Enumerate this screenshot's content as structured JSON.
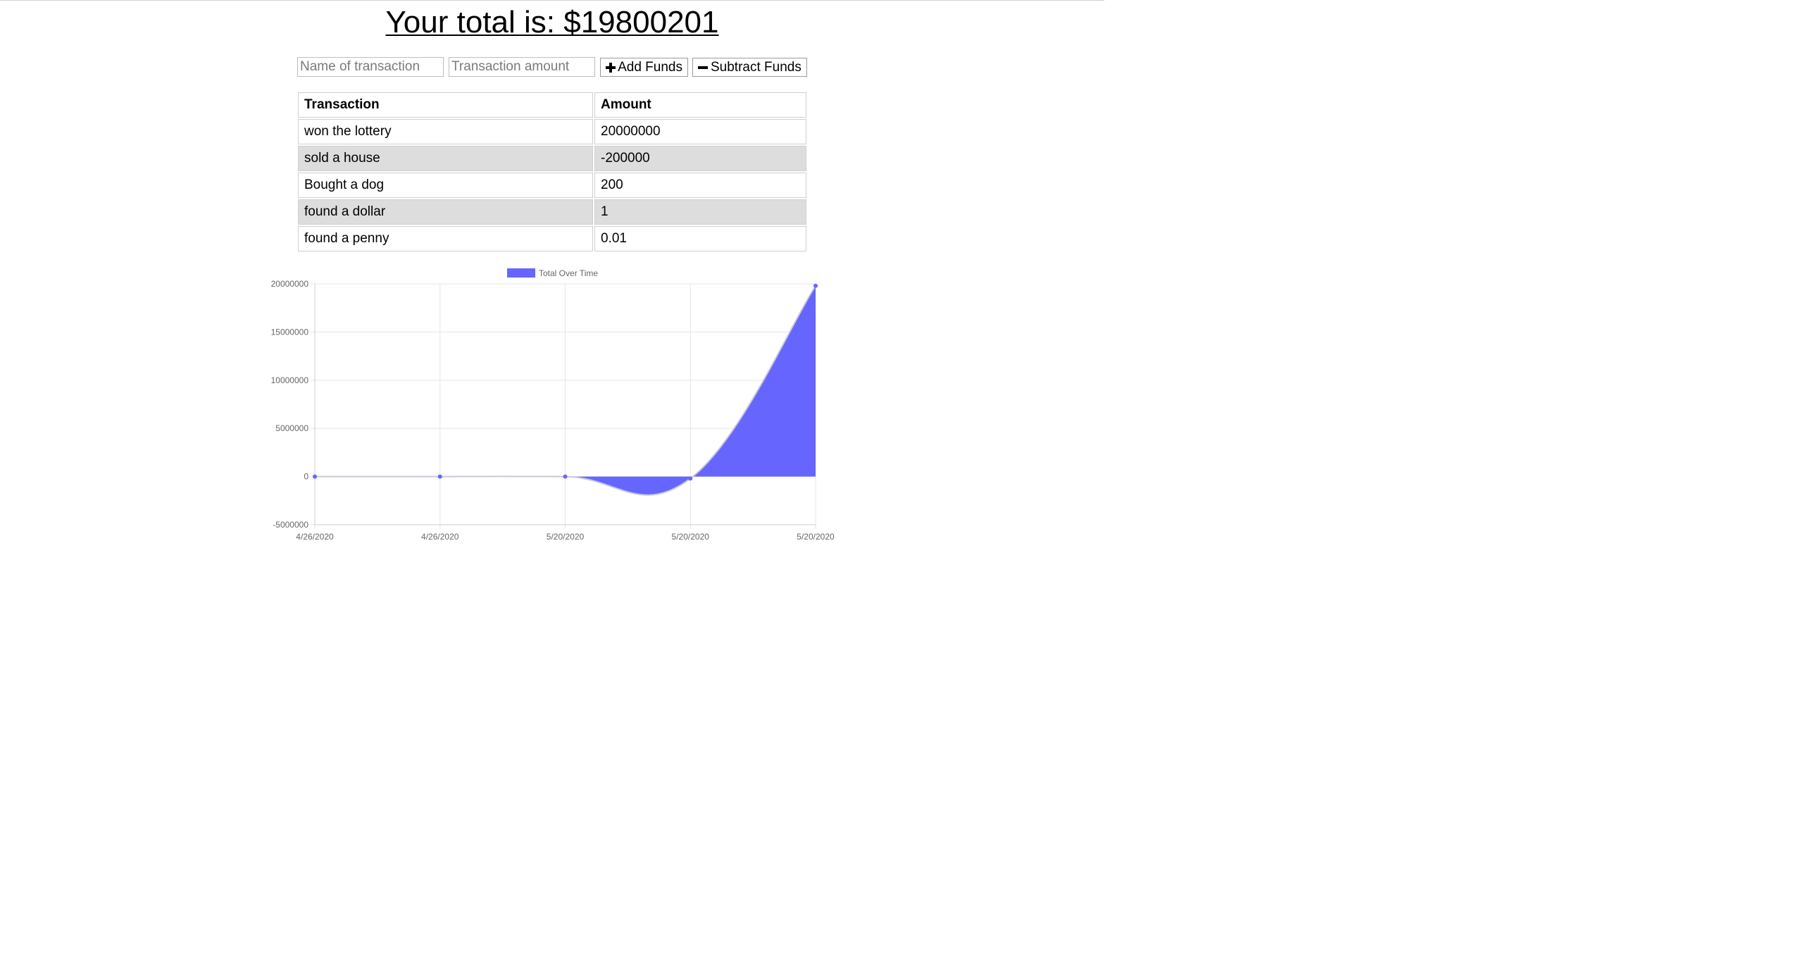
{
  "header": {
    "total_text": "Your total is: $19800201"
  },
  "form": {
    "name_placeholder": "Name of transaction",
    "amount_placeholder": "Transaction amount",
    "add_label": "Add Funds",
    "subtract_label": "Subtract Funds"
  },
  "table": {
    "headers": [
      "Transaction",
      "Amount"
    ],
    "rows": [
      {
        "name": "won the lottery",
        "amount": "20000000"
      },
      {
        "name": "sold a house",
        "amount": "-200000"
      },
      {
        "name": "Bought a dog",
        "amount": "200"
      },
      {
        "name": "found a dollar",
        "amount": "1"
      },
      {
        "name": "found a penny",
        "amount": "0.01"
      }
    ]
  },
  "chart_data": {
    "type": "area",
    "title": "",
    "xlabel": "",
    "ylabel": "",
    "categories": [
      "4/26/2020",
      "4/26/2020",
      "5/20/2020",
      "5/20/2020",
      "5/20/2020"
    ],
    "series": [
      {
        "name": "Total Over Time",
        "values": [
          0,
          0,
          0,
          -200000,
          19800000
        ],
        "color": "#6666ff"
      }
    ],
    "ylim": [
      -5000000,
      20000000
    ],
    "yticks": [
      "20000000",
      "15000000",
      "10000000",
      "5000000",
      "0",
      "-5000000"
    ],
    "grid": true,
    "legend": "top"
  }
}
